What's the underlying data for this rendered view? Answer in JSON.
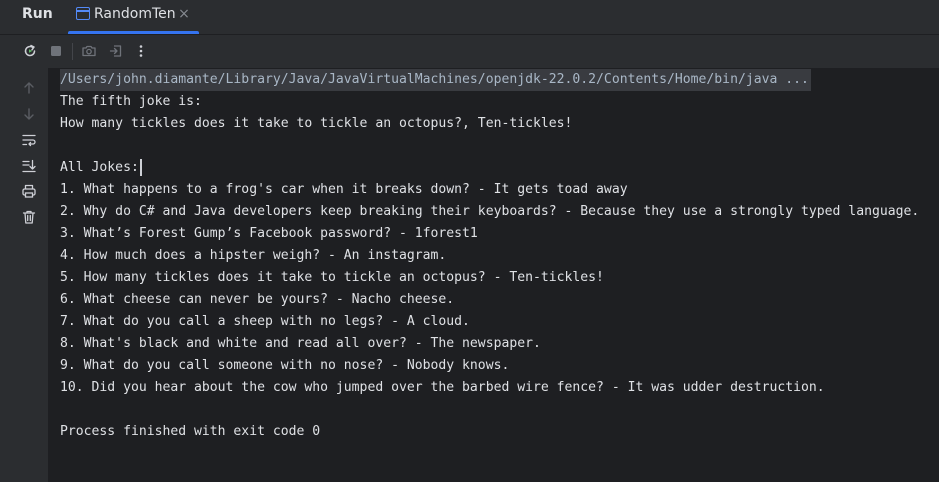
{
  "window": {
    "run_label": "Run",
    "tab_title": "RandomTen",
    "tab_close": "×",
    "accent_color": "#3574f0"
  },
  "toolbar": {
    "buttons": [
      "rerun-icon",
      "stop-icon",
      "camera-icon",
      "exit-icon",
      "more-vertical-icon"
    ]
  },
  "sidebar": {
    "buttons": [
      "arrow-up-icon",
      "arrow-down-icon",
      "soft-wrap-icon",
      "scroll-to-end-icon",
      "print-icon",
      "trash-icon"
    ]
  },
  "console": {
    "command": "/Users/john.diamante/Library/Java/JavaVirtualMachines/openjdk-22.0.2/Contents/Home/bin/java ...",
    "lines": [
      "The fifth joke is:",
      "How many tickles does it take to tickle an octopus?, Ten-tickles!",
      "",
      "All Jokes:",
      "1. What happens to a frog's car when it breaks down? - It gets toad away",
      "2. Why do C# and Java developers keep breaking their keyboards? - Because they use a strongly typed language.",
      "3. What’s Forest Gump’s Facebook password? - 1forest1",
      "4. How much does a hipster weigh? - An instagram.",
      "5. How many tickles does it take to tickle an octopus? - Ten-tickles!",
      "6. What cheese can never be yours? - Nacho cheese.",
      "7. What do you call a sheep with no legs? - A cloud.",
      "8. What's black and white and read all over? - The newspaper.",
      "9. What do you call someone with no nose? - Nobody knows.",
      "10. Did you hear about the cow who jumped over the barbed wire fence? - It was udder destruction.",
      "",
      "Process finished with exit code 0"
    ]
  }
}
